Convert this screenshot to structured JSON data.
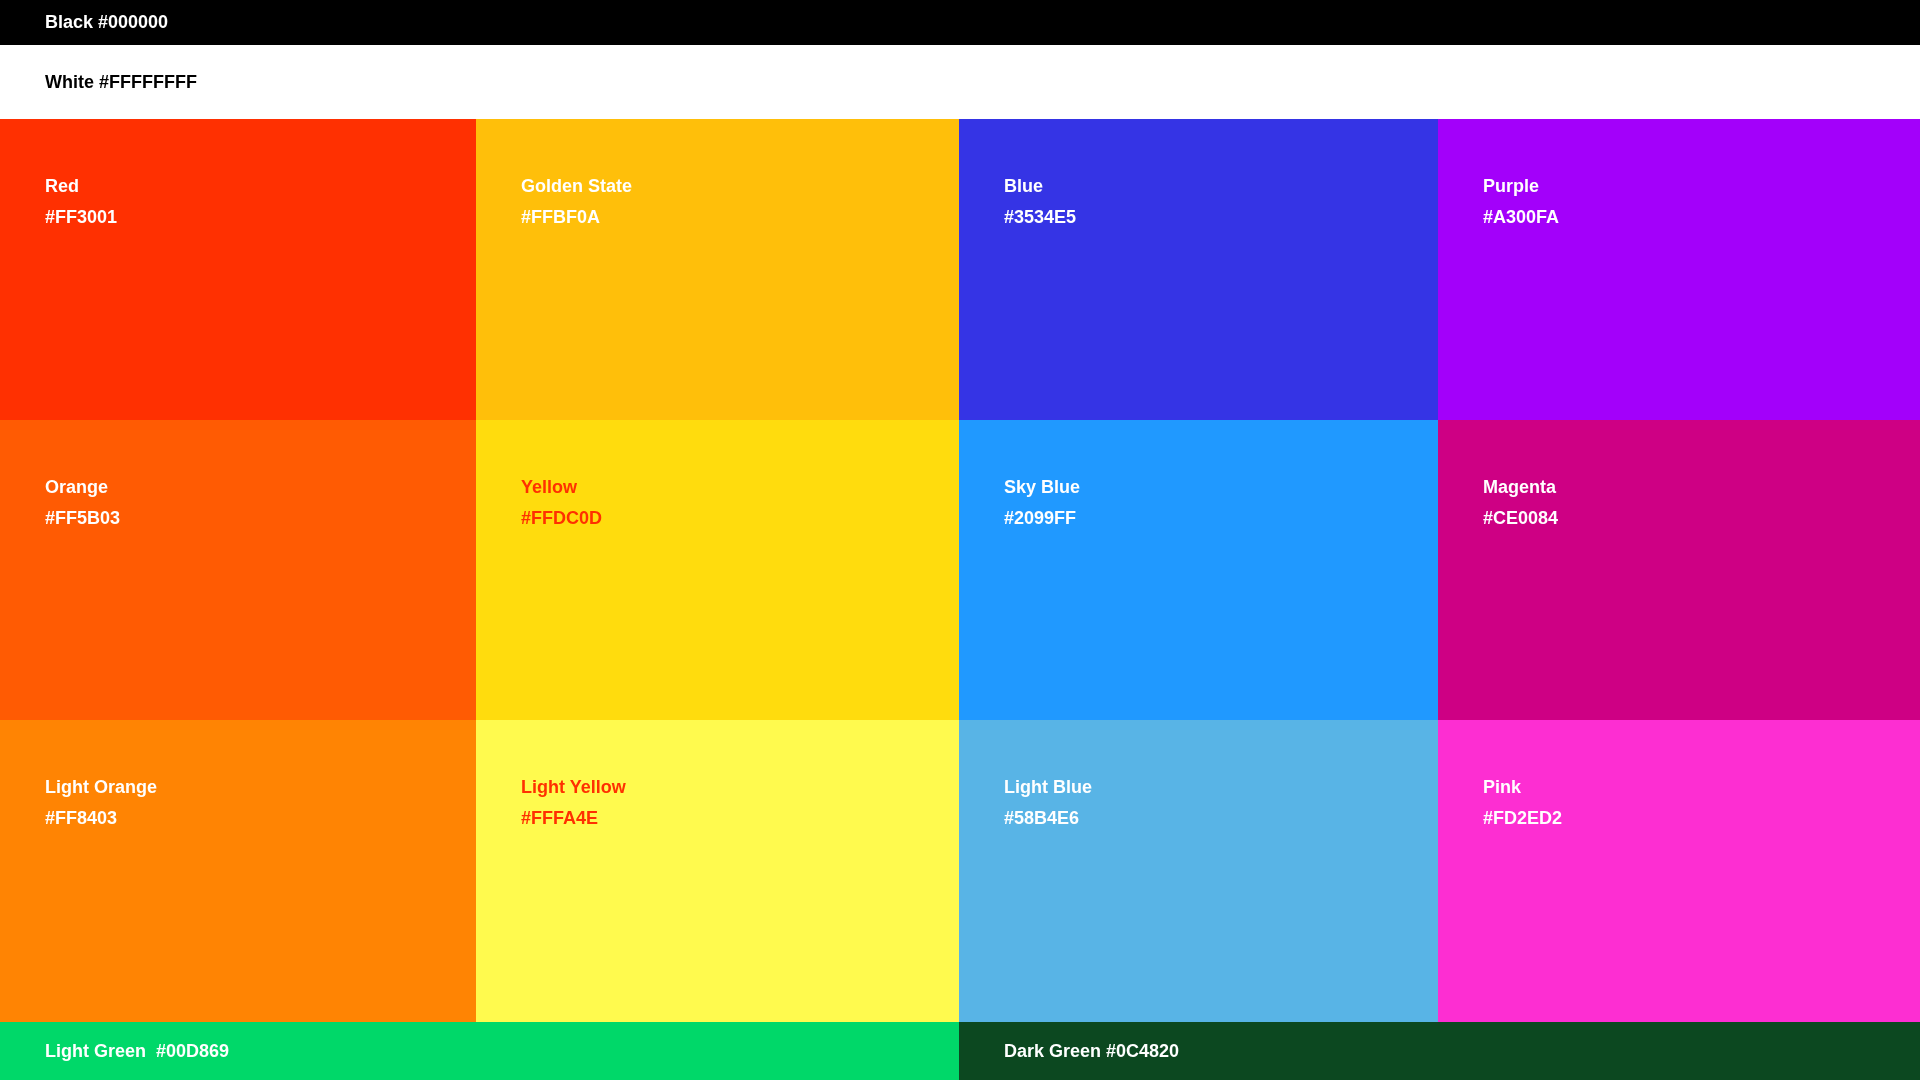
{
  "top_bars": [
    {
      "label": "Black #000000",
      "color": "#000000",
      "kind": "light"
    },
    {
      "label": "White #FFFFFFFF",
      "color": "#ffffff",
      "kind": "dark"
    }
  ],
  "swatches": [
    {
      "name": "Red",
      "code": "#FF3001",
      "color": "#ff3001",
      "kind": "light"
    },
    {
      "name": "Golden State",
      "code": "#FFBF0A",
      "color": "#ffbf0a",
      "kind": "light"
    },
    {
      "name": "Blue",
      "code": "#3534E5",
      "color": "#3534e5",
      "kind": "light"
    },
    {
      "name": "Purple",
      "code": "#A300FA",
      "color": "#a300fa",
      "kind": "light"
    },
    {
      "name": "Orange",
      "code": "#FF5B03",
      "color": "#ff5b03",
      "kind": "light"
    },
    {
      "name": "Yellow",
      "code": "#FFDC0D",
      "color": "#ffdc0d",
      "kind": "accent"
    },
    {
      "name": "Sky Blue",
      "code": "#2099FF",
      "color": "#2099ff",
      "kind": "light"
    },
    {
      "name": "Magenta",
      "code": "#CE0084",
      "color": "#ce0084",
      "kind": "light"
    },
    {
      "name": "Light Orange",
      "code": "#FF8403",
      "color": "#ff8403",
      "kind": "light"
    },
    {
      "name": "Light Yellow",
      "code": "#FFFA4E",
      "color": "#fffa4e",
      "kind": "accent"
    },
    {
      "name": "Light Blue",
      "code": "#58B4E6",
      "color": "#58b4e6",
      "kind": "light"
    },
    {
      "name": "Pink",
      "code": "#FD2ED2",
      "color": "#fd2ed2",
      "kind": "light"
    }
  ],
  "bottom_bars": [
    {
      "label": "Light Green  #00D869",
      "color": "#00d869",
      "kind": "light"
    },
    {
      "label": "Dark Green #0C4820",
      "color": "#0c4820",
      "kind": "light"
    }
  ]
}
